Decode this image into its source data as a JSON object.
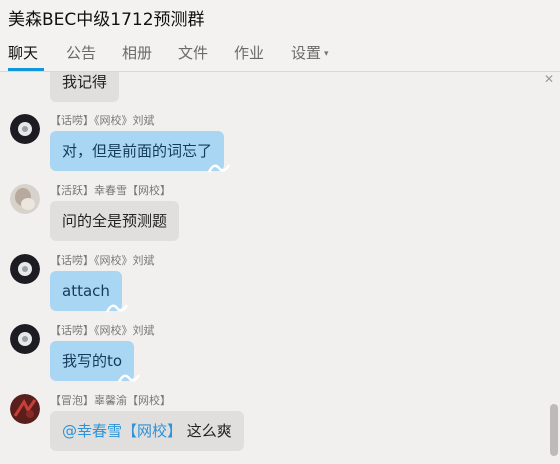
{
  "window": {
    "title": "美森BEC中级1712预测群"
  },
  "tabs": [
    {
      "label": "聊天"
    },
    {
      "label": "公告"
    },
    {
      "label": "相册"
    },
    {
      "label": "文件"
    },
    {
      "label": "作业"
    },
    {
      "label": "设置"
    }
  ],
  "messages": [
    {
      "meta": "",
      "text": "我记得"
    },
    {
      "meta": "【话唠】《网校》刘斌",
      "text": "对，但是前面的词忘了"
    },
    {
      "meta": "【活跃】幸春雪【网校】",
      "text": "问的全是预测题"
    },
    {
      "meta": "【话唠】《网校》刘斌",
      "text": "attach"
    },
    {
      "meta": "【话唠】《网校》刘斌",
      "text": "我写的to"
    },
    {
      "meta": "【冒泡】辜馨渝【网校】",
      "mention": "@幸春雪【网校】",
      "text": " 这么爽"
    }
  ],
  "colors": {
    "accent": "#1296db",
    "bubble_blue": "#a8d6f3",
    "bubble_gray": "#e1dfdd"
  },
  "icons": {
    "close": "close-icon",
    "settings_dropdown": "chevron-down-icon"
  }
}
